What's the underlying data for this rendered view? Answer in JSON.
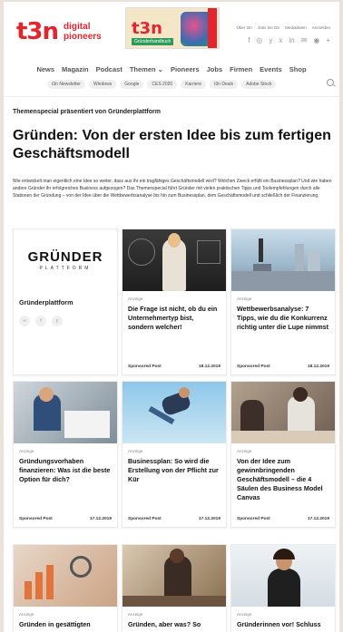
{
  "header": {
    "logo_mark": "t3n",
    "logo_text_1": "digital",
    "logo_text_2": "pioneers",
    "magazine_title": "t3n",
    "magazine_badge": "Gründerhandbuch",
    "top_links": [
      "Über t3n",
      "Jobs bei t3n",
      "Mediadaten",
      "Anmelden"
    ],
    "social_icons": [
      "facebook-icon",
      "instagram-icon",
      "twitter-icon",
      "xing-icon",
      "linkedin-icon",
      "mail-icon",
      "rss-icon",
      "plus-icon"
    ]
  },
  "nav": {
    "items": [
      "News",
      "Magazin",
      "Podcast",
      "Themen ⌄",
      "Pioneers",
      "Jobs",
      "Firmen",
      "Events",
      "Shop"
    ],
    "tags": [
      "t3n Newsletter",
      "Windows",
      "Google",
      "CES 2020",
      "Karriere",
      "t3n Deals",
      "Adobe Stock"
    ]
  },
  "intro": {
    "special_label": "Themenspecial präsentiert von Gründerplattform",
    "title": "Gründen: Von der ersten Idee bis zum fertigen Geschäftsmodell",
    "lead": "Wie entwickelt man eigentlich eine Idee so weiter, dass aus ihr ein tragfähiges Geschäftsmodell wird? Welchen Zweck erfüllt ein Businessplan? Und wie haben andere Gründer ihr erfolgreiches Business aufgezogen? Das Themenspecial führt Gründer mit vielen praktischen Tipps und Toolempfehlungen durch alle Stationen der Gründung – von der Idee über die Wettbewerbsanalyse bis hin zum Businessplan, dem Geschäftsmodell und schließlich der Finanzierung."
  },
  "brand_card": {
    "brand_word": "GRÜNDER",
    "brand_sub": "PLATTFORM",
    "name": "Gründerplattform"
  },
  "cards": [
    {
      "anzeige": "Anzeige",
      "title": "Die Frage ist nicht, ob du ein Unternehmertyp bist, sondern welcher!",
      "sponsored": "Sponsored Post",
      "date": "18.12.2019"
    },
    {
      "anzeige": "Anzeige",
      "title": "Wettbewerbsanalyse: 7 Tipps, wie du die Konkurrenz richtig unter die Lupe nimmst",
      "sponsored": "Sponsored Post",
      "date": "18.12.2019"
    },
    {
      "anzeige": "Anzeige",
      "title": "Gründungsvorhaben finanzieren: Was ist die beste Option für dich?",
      "sponsored": "Sponsored Post",
      "date": "17.12.2019"
    },
    {
      "anzeige": "Anzeige",
      "title": "Businessplan: So wird die Erstellung von der Pflicht zur Kür",
      "sponsored": "Sponsored Post",
      "date": "17.12.2019"
    },
    {
      "anzeige": "Anzeige",
      "title": "Von der Idee zum gewinnbringenden Geschäftsmodell – die 4 Säulen des Business Model Canvas",
      "sponsored": "Sponsored Post",
      "date": "17.12.2019"
    },
    {
      "anzeige": "Anzeige",
      "title": "Gründen in gesättigten",
      "sponsored": "",
      "date": ""
    },
    {
      "anzeige": "Anzeige",
      "title": "Gründen, aber was? So",
      "sponsored": "",
      "date": ""
    },
    {
      "anzeige": "Anzeige",
      "title": "Gründerinnen vor! Schluss",
      "sponsored": "",
      "date": ""
    }
  ]
}
